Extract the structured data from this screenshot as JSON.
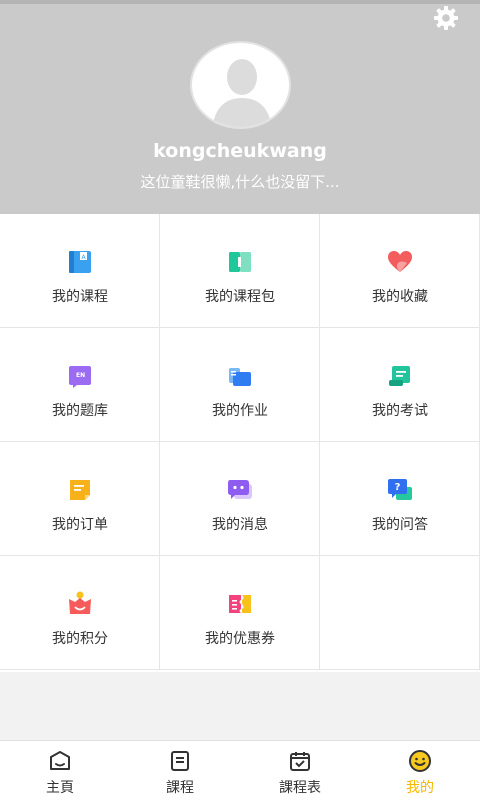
{
  "profile": {
    "username": "kongcheukwang",
    "bio": "这位童鞋很懒,什么也没留下..."
  },
  "menu": {
    "items": [
      {
        "label": "我的课程",
        "icon": "course-book-icon"
      },
      {
        "label": "我的课程包",
        "icon": "course-package-icon"
      },
      {
        "label": "我的收藏",
        "icon": "heart-favorite-icon"
      },
      {
        "label": "我的题库",
        "icon": "question-bank-icon"
      },
      {
        "label": "我的作业",
        "icon": "homework-folder-icon"
      },
      {
        "label": "我的考试",
        "icon": "exam-scroll-icon"
      },
      {
        "label": "我的订单",
        "icon": "order-note-icon"
      },
      {
        "label": "我的消息",
        "icon": "message-bubble-icon"
      },
      {
        "label": "我的问答",
        "icon": "qa-bubble-icon"
      },
      {
        "label": "我的积分",
        "icon": "points-gift-icon"
      },
      {
        "label": "我的优惠券",
        "icon": "coupon-ticket-icon"
      }
    ]
  },
  "tabbar": {
    "items": [
      {
        "label": "主頁",
        "icon": "home-icon"
      },
      {
        "label": "課程",
        "icon": "course-list-icon"
      },
      {
        "label": "課程表",
        "icon": "calendar-icon"
      },
      {
        "label": "我的",
        "icon": "smiley-profile-icon"
      }
    ],
    "active_index": 3,
    "active_color": "#f5b800"
  },
  "colors": {
    "header_bg": "#cacaca",
    "accent": "#f5b800"
  }
}
